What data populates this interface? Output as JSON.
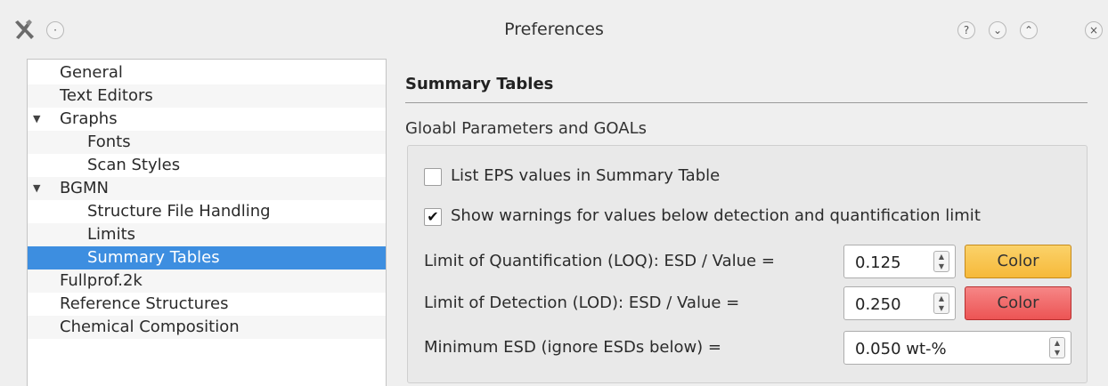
{
  "window": {
    "title": "Preferences",
    "controls": {
      "help": "?",
      "minimize": "⌄",
      "maximize": "⌃",
      "close": "×",
      "menu": "·"
    }
  },
  "tree": {
    "items": [
      {
        "label": "General",
        "level": 0
      },
      {
        "label": "Text Editors",
        "level": 0
      },
      {
        "label": "Graphs",
        "level": 0,
        "expanded": true
      },
      {
        "label": "Fonts",
        "level": 1
      },
      {
        "label": "Scan Styles",
        "level": 1
      },
      {
        "label": "BGMN",
        "level": 0,
        "expanded": true
      },
      {
        "label": "Structure File Handling",
        "level": 1
      },
      {
        "label": "Limits",
        "level": 1
      },
      {
        "label": "Summary Tables",
        "level": 1,
        "selected": true
      },
      {
        "label": "Fullprof.2k",
        "level": 0
      },
      {
        "label": "Reference Structures",
        "level": 0
      },
      {
        "label": "Chemical Composition",
        "level": 0
      }
    ]
  },
  "panel": {
    "section_title": "Summary Tables",
    "group_title": "Gloabl Parameters and GOALs",
    "list_eps": {
      "label": "List EPS values in Summary Table",
      "checked": false
    },
    "show_warnings": {
      "label": "Show warnings for values below detection and quantification limit",
      "checked": true,
      "mark": "✔"
    },
    "loq": {
      "label": "Limit of Quantification (LOQ): ESD / Value =",
      "value": "0.125",
      "button": "Color",
      "color": "#f6b93a"
    },
    "lod": {
      "label": "Limit of Detection (LOD): ESD / Value =",
      "value": "0.250",
      "button": "Color",
      "color": "#ec5454"
    },
    "min_esd": {
      "label": "Minimum ESD (ignore ESDs below) =",
      "value": "0.050 wt-%"
    }
  },
  "colors": {
    "selection": "#3d8ee0"
  }
}
